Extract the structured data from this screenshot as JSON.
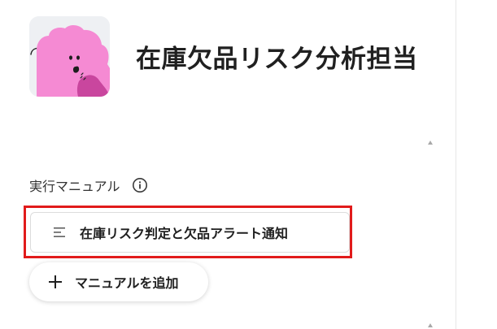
{
  "header": {
    "title": "在庫欠品リスク分析担当",
    "avatar_icon": "pink-blob-character-icon"
  },
  "section": {
    "label": "実行マニュアル",
    "info_icon": "info-icon"
  },
  "manuals": [
    {
      "label": "在庫リスク判定と欠品アラート通知",
      "icon": "menu-lines-icon",
      "highlighted": true
    }
  ],
  "actions": {
    "add_manual_label": "マニュアルを追加",
    "add_icon": "plus-icon"
  },
  "colors": {
    "highlight": "#e11b1b",
    "avatar_bg": "#eef0f3",
    "avatar_pink": "#f58ad3",
    "avatar_dark_pink": "#c9469e"
  }
}
